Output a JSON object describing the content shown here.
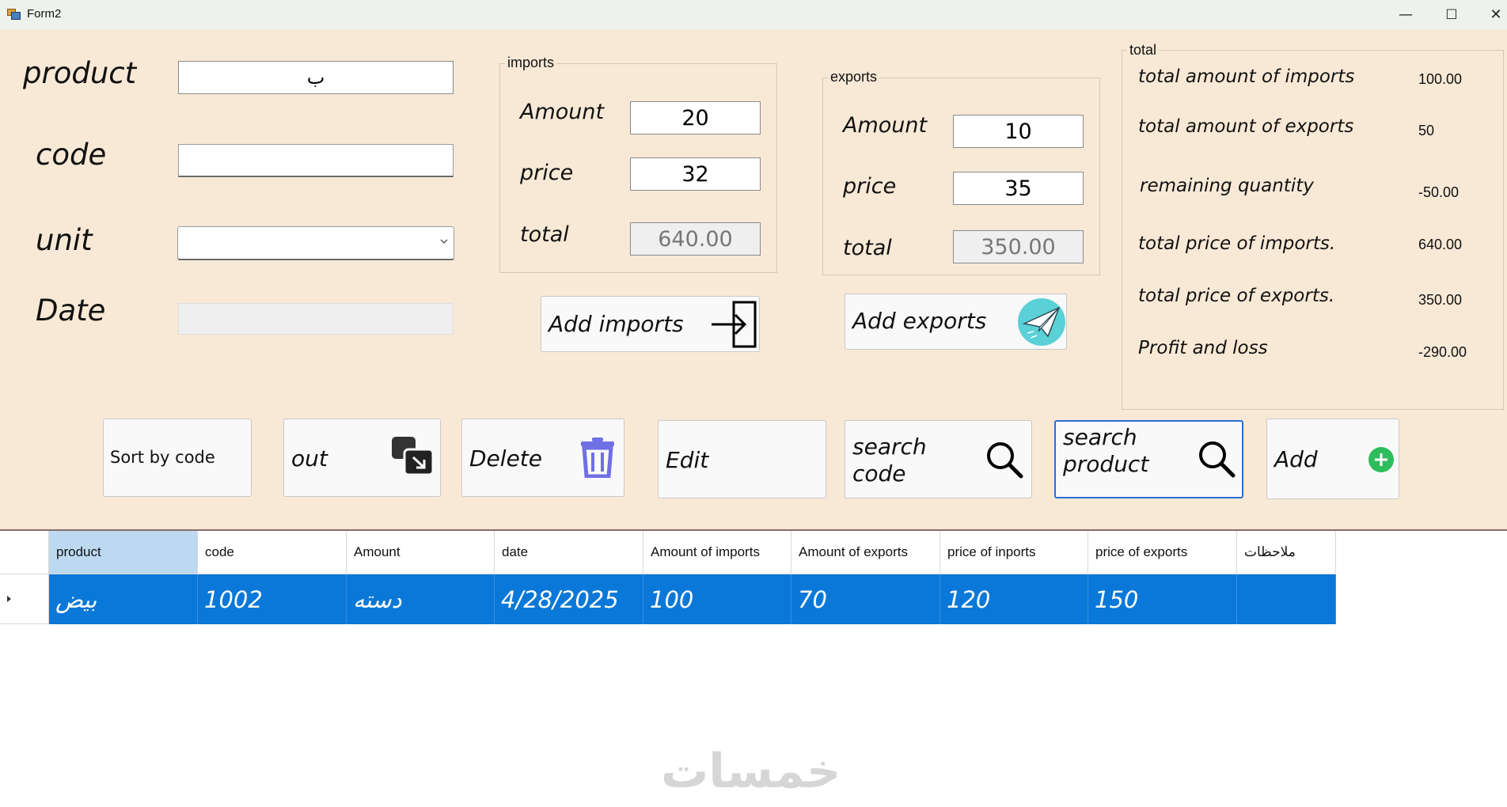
{
  "window": {
    "title": "Form2",
    "min": "—",
    "max": "☐",
    "close": "✕"
  },
  "form": {
    "product_label": "product",
    "product_value": "ب",
    "code_label": "code",
    "code_value": "",
    "unit_label": "unit",
    "unit_value": "",
    "date_label": "Date",
    "date_value": ""
  },
  "imports": {
    "title": "imports",
    "amount_label": "Amount",
    "amount_value": "20",
    "price_label": "price",
    "price_value": "32",
    "total_label": "total",
    "total_value": "640.00",
    "add_button": "Add imports"
  },
  "exports": {
    "title": "exports",
    "amount_label": "Amount",
    "amount_value": "10",
    "price_label": "price",
    "price_value": "35",
    "total_label": "total",
    "total_value": "350.00",
    "add_button": "Add exports"
  },
  "totals": {
    "title": "total",
    "rows": [
      {
        "label": "total amount of imports",
        "value": "100.00"
      },
      {
        "label": "total amount of exports",
        "value": "50"
      },
      {
        "label": "remaining quantity",
        "value": "-50.00"
      },
      {
        "label": "total price of imports.",
        "value": "640.00"
      },
      {
        "label": "total price of exports.",
        "value": "350.00"
      },
      {
        "label": "Profit and loss",
        "value": "-290.00"
      }
    ]
  },
  "buttons": {
    "sort": "Sort by code",
    "out": "out",
    "delete": "Delete",
    "edit": "Edit",
    "search_code_1": "search",
    "search_code_2": "code",
    "search_product_1": "search",
    "search_product_2": "product",
    "add": "Add"
  },
  "grid": {
    "columns": [
      "product",
      "code",
      "Amount",
      "date",
      "Amount of imports",
      "Amount of exports",
      "price of inports",
      "price of exports",
      "ملاحظات"
    ],
    "rows": [
      [
        "بيض",
        "1002",
        "دسته",
        "4/28/2025",
        "100",
        "70",
        "120",
        "150",
        ""
      ]
    ]
  },
  "watermark": "خمسات",
  "colors": {
    "form_bg": "#f8e9d6",
    "selection": "#0a78d8",
    "add_green": "#2dbd5c",
    "delete_purple": "#6f6fe6",
    "send_teal": "#5ad1d6"
  }
}
